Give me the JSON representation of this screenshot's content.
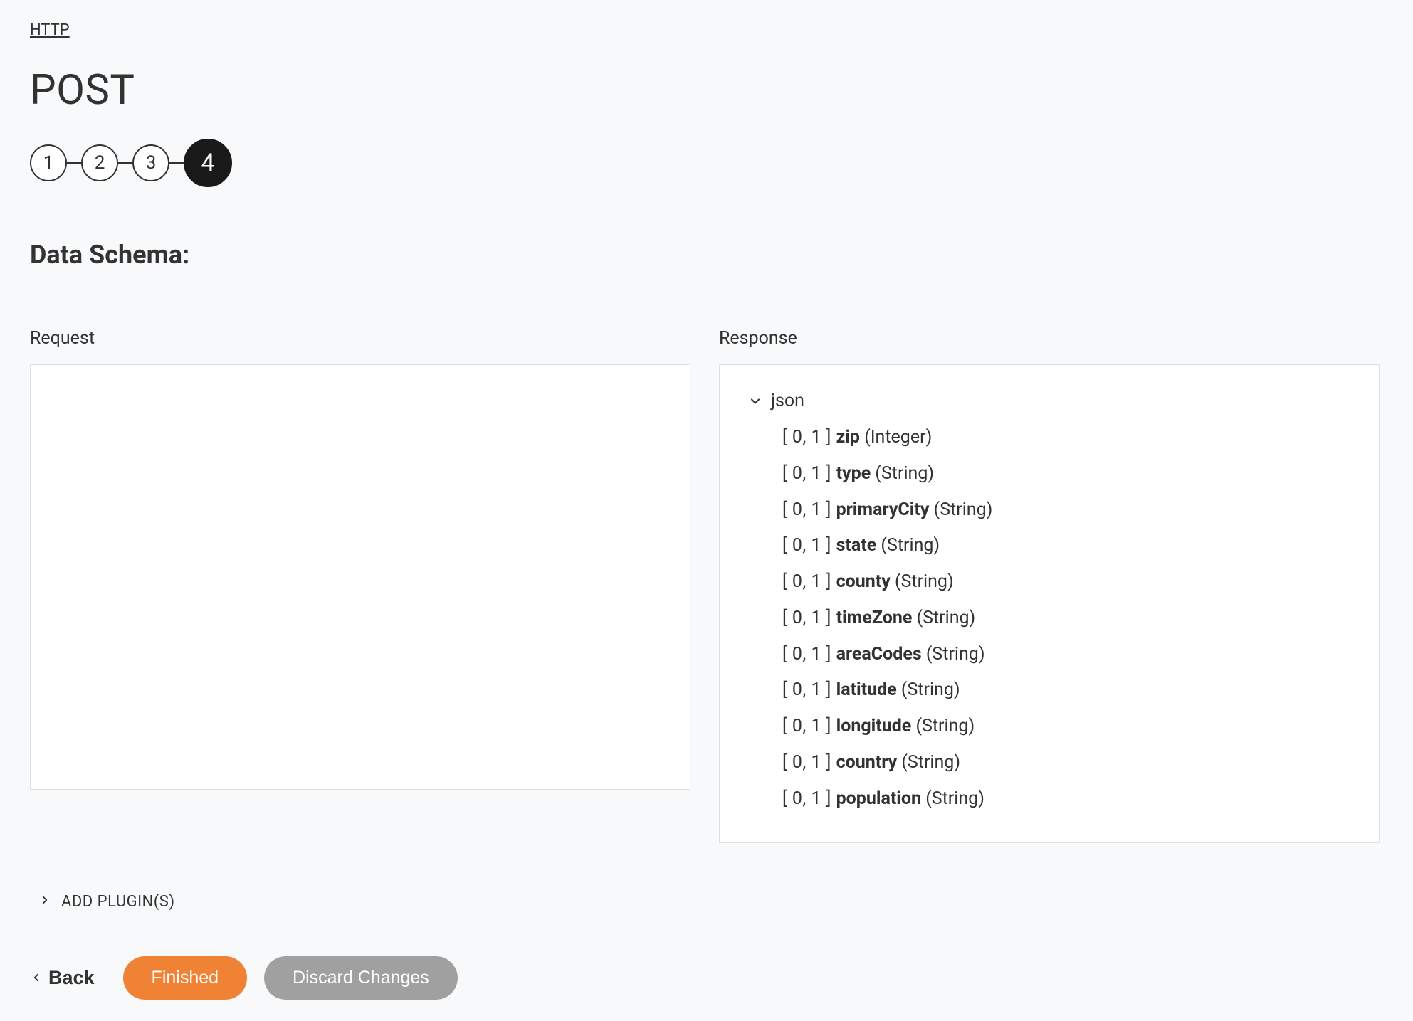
{
  "breadcrumb": {
    "label": "HTTP"
  },
  "page_title": "POST",
  "stepper": {
    "steps": [
      "1",
      "2",
      "3",
      "4"
    ],
    "active_index": 3
  },
  "section_heading": "Data Schema:",
  "panels": {
    "request": {
      "label": "Request"
    },
    "response": {
      "label": "Response",
      "root_label": "json",
      "fields": [
        {
          "cardinality": "[ 0, 1 ]",
          "name": "zip",
          "type": "(Integer)"
        },
        {
          "cardinality": "[ 0, 1 ]",
          "name": "type",
          "type": "(String)"
        },
        {
          "cardinality": "[ 0, 1 ]",
          "name": "primaryCity",
          "type": "(String)"
        },
        {
          "cardinality": "[ 0, 1 ]",
          "name": "state",
          "type": "(String)"
        },
        {
          "cardinality": "[ 0, 1 ]",
          "name": "county",
          "type": "(String)"
        },
        {
          "cardinality": "[ 0, 1 ]",
          "name": "timeZone",
          "type": "(String)"
        },
        {
          "cardinality": "[ 0, 1 ]",
          "name": "areaCodes",
          "type": "(String)"
        },
        {
          "cardinality": "[ 0, 1 ]",
          "name": "latitude",
          "type": "(String)"
        },
        {
          "cardinality": "[ 0, 1 ]",
          "name": "longitude",
          "type": "(String)"
        },
        {
          "cardinality": "[ 0, 1 ]",
          "name": "country",
          "type": "(String)"
        },
        {
          "cardinality": "[ 0, 1 ]",
          "name": "population",
          "type": "(String)"
        }
      ]
    }
  },
  "add_plugins_label": "ADD PLUGIN(S)",
  "footer": {
    "back_label": "Back",
    "finished_label": "Finished",
    "discard_label": "Discard Changes"
  }
}
